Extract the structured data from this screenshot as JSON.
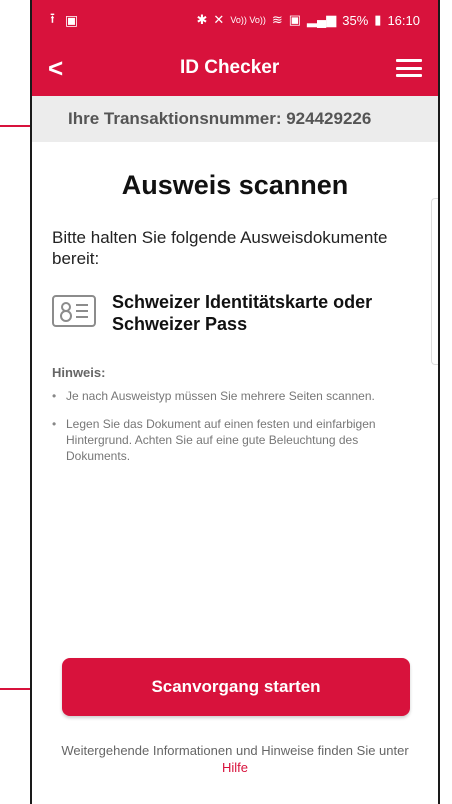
{
  "status_bar": {
    "left_icons": [
      "upload-icon",
      "image-icon"
    ],
    "right_text": "35%",
    "time": "16:10"
  },
  "app_bar": {
    "back": "<",
    "title": "ID Checker"
  },
  "transaction": {
    "label": "Ihre Transaktionsnummer: 924429226"
  },
  "main": {
    "heading": "Ausweis scannen",
    "intro": "Bitte halten Sie folgende Ausweisdokumente bereit:",
    "document_text": "Schweizer Identitätskarte oder Schweizer Pass",
    "hint_title": "Hinweis:",
    "hints": [
      "Je nach Ausweistyp müssen Sie mehrere Seiten scannen.",
      "Legen Sie das Dokument auf einen festen und einfarbigen Hintergrund. Achten Sie auf eine gute Beleuchtung des Dokuments."
    ]
  },
  "actions": {
    "start_scan": "Scanvorgang starten"
  },
  "footer": {
    "text": "Weitergehende Informationen und Hinweise finden Sie unter",
    "link": "Hilfe"
  },
  "colors": {
    "brand": "#d8123c"
  }
}
